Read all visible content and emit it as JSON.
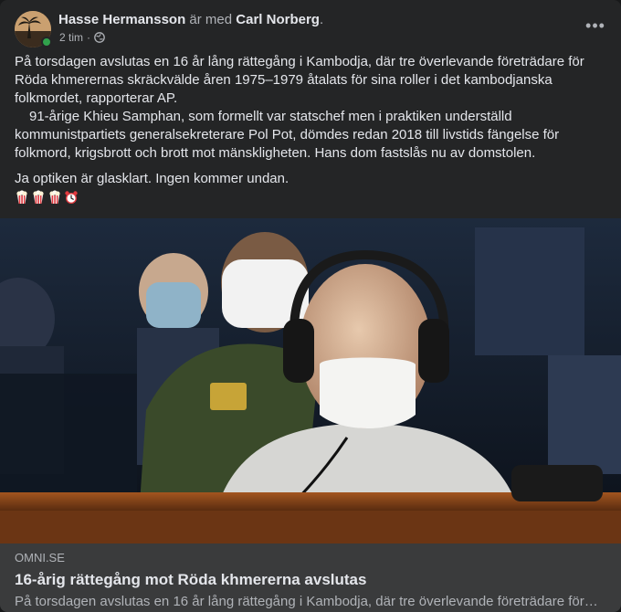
{
  "post": {
    "author": "Hasse Hermansson",
    "with_text": "är med",
    "tagged": "Carl Norberg",
    "tagged_suffix": ".",
    "time": "2 tim",
    "separator": "·",
    "audience_icon": "globe-icon",
    "more_icon": "more-options-icon",
    "more_label": "•••"
  },
  "body": {
    "paragraph1": "På torsdagen avslutas en 16 år lång rättegång i Kambodja, där tre överlevande företrädare för Röda khmerernas skräckvälde åren 1975–1979 åtalats för sina roller i det kambodjanska folkmordet, rapporterar AP.",
    "paragraph2": "91-årige Khieu Samphan, som formellt var statschef men i praktiken underställd kommunistpartiets generalsekreterare Pol Pot, dömdes redan 2018 till livstids fängelse för folkmord, krigsbrott och brott mot mänskligheten. Hans dom fastslås nu av domstolen.",
    "paragraph3": "Ja optiken är glasklart. Ingen kommer undan.",
    "emojis": [
      "popcorn-icon",
      "popcorn-icon",
      "popcorn-icon",
      "alarm-clock-icon"
    ]
  },
  "link": {
    "domain": "OMNI.SE",
    "title": "16-årig rättegång mot Röda khmererna avslutas",
    "description": "På torsdagen avslutas en 16 år lång rättegång i Kambodja, där tre överlevande företrädare för…"
  },
  "colors": {
    "card_bg": "#242526",
    "link_bg": "#3a3b3c",
    "text_primary": "#e4e6eb",
    "text_secondary": "#b0b3b8",
    "online": "#31a24c"
  }
}
